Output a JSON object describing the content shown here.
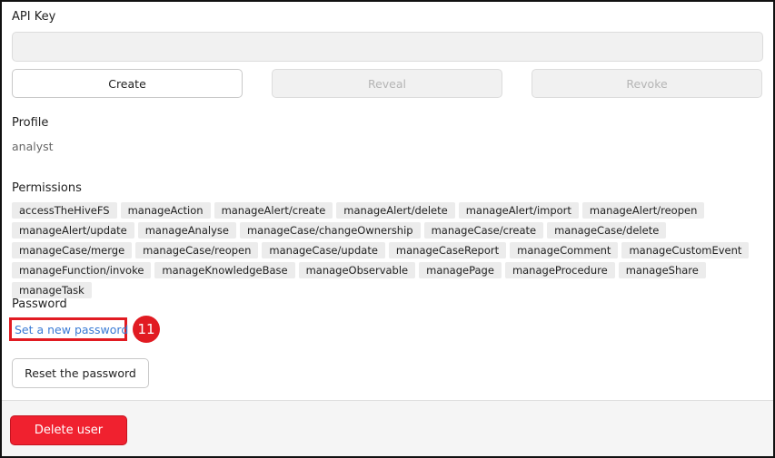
{
  "api_key": {
    "label": "API Key",
    "value": "",
    "buttons": {
      "create": "Create",
      "reveal": "Reveal",
      "revoke": "Revoke"
    }
  },
  "profile": {
    "label": "Profile",
    "value": "analyst"
  },
  "permissions": {
    "label": "Permissions",
    "items": [
      "accessTheHiveFS",
      "manageAction",
      "manageAlert/create",
      "manageAlert/delete",
      "manageAlert/import",
      "manageAlert/reopen",
      "manageAlert/update",
      "manageAnalyse",
      "manageCase/changeOwnership",
      "manageCase/create",
      "manageCase/delete",
      "manageCase/merge",
      "manageCase/reopen",
      "manageCase/update",
      "manageCaseReport",
      "manageComment",
      "manageCustomEvent",
      "manageFunction/invoke",
      "manageKnowledgeBase",
      "manageObservable",
      "managePage",
      "manageProcedure",
      "manageShare",
      "manageTask"
    ]
  },
  "password": {
    "label": "Password",
    "set_link": "Set a new password",
    "annotation_badge": "11",
    "reset_button": "Reset the password"
  },
  "footer": {
    "delete_button": "Delete user"
  },
  "colors": {
    "danger": "#f0212f",
    "annotation": "#e11b22",
    "link": "#3a7bd5"
  }
}
